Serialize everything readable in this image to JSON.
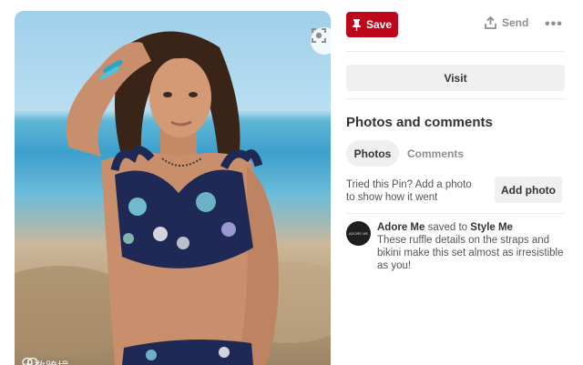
{
  "photo": {
    "lens_icon": "visual-search-icon",
    "watermark_text": "大数跨境"
  },
  "actions": {
    "save_label": "Save",
    "save_icon": "pin-icon",
    "send_label": "Send",
    "send_icon": "share-upload-icon",
    "more_label": "•••",
    "visit_label": "Visit"
  },
  "comments_section": {
    "title": "Photos and comments",
    "tabs": [
      {
        "label": "Photos",
        "active": true
      },
      {
        "label": "Comments",
        "active": false
      }
    ],
    "tried_prompt": "Tried this Pin? Add a photo to show how it went",
    "add_photo_label": "Add photo"
  },
  "pin_info": {
    "avatar_text": "ADORE ME",
    "user": "Adore Me",
    "saved_to_text": "saved to",
    "board": "Style Me",
    "description": "These ruffle details on the straps and bikini make this set almost as irresistible as you!"
  },
  "colors": {
    "brand_red": "#bd081c",
    "button_gray": "#efefef"
  }
}
